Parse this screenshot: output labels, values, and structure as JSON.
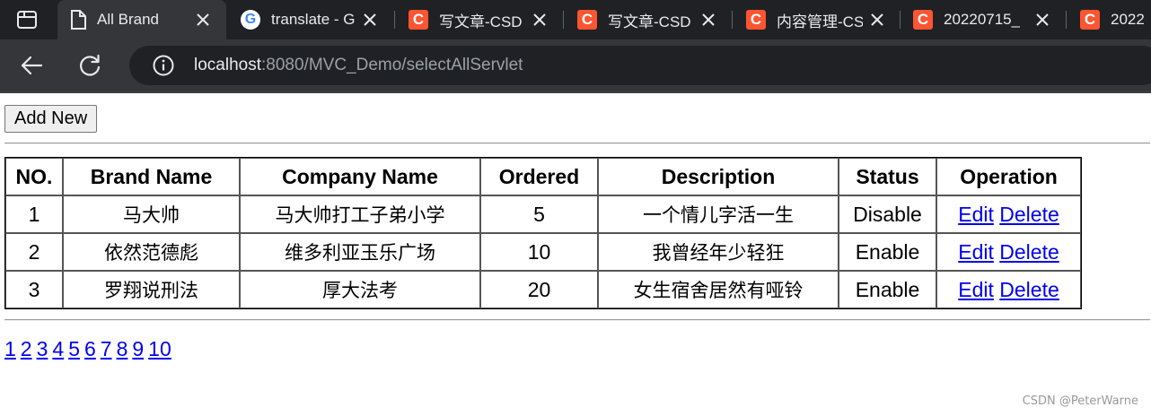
{
  "browser": {
    "tabs": [
      {
        "title": "All Brand",
        "favicon": "page-icon",
        "active": true
      },
      {
        "title": "translate - G",
        "favicon": "google-icon",
        "active": false
      },
      {
        "title": "写文章-CSDN",
        "favicon": "csdn-icon",
        "active": false
      },
      {
        "title": "写文章-CSDN",
        "favicon": "csdn-icon",
        "active": false
      },
      {
        "title": "内容管理-CSDN",
        "favicon": "csdn-icon",
        "active": false
      },
      {
        "title": "20220715_",
        "favicon": "csdn-icon",
        "active": false
      },
      {
        "title": "2022",
        "favicon": "csdn-icon",
        "active": false
      }
    ],
    "address": {
      "host": "localhost",
      "path": ":8080/MVC_Demo/selectAllServlet"
    },
    "favicon_letters": {
      "csdn": "C",
      "google": "G"
    }
  },
  "page": {
    "add_button": "Add New",
    "table": {
      "headers": [
        "NO.",
        "Brand Name",
        "Company Name",
        "Ordered",
        "Description",
        "Status",
        "Operation"
      ],
      "rows": [
        {
          "no": "1",
          "brand": "马大帅",
          "company": "马大帅打工子弟小学",
          "ordered": "5",
          "description": "一个情儿字活一生",
          "status": "Disable",
          "edit": "Edit",
          "delete": "Delete"
        },
        {
          "no": "2",
          "brand": "依然范德彪",
          "company": "维多利亚玉乐广场",
          "ordered": "10",
          "description": "我曾经年少轻狂",
          "status": "Enable",
          "edit": "Edit",
          "delete": "Delete"
        },
        {
          "no": "3",
          "brand": "罗翔说刑法",
          "company": "厚大法考",
          "ordered": "20",
          "description": "女生宿舍居然有哑铃",
          "status": "Enable",
          "edit": "Edit",
          "delete": "Delete"
        }
      ]
    },
    "pagination": [
      "1",
      "2",
      "3",
      "4",
      "5",
      "6",
      "7",
      "8",
      "9",
      "10"
    ],
    "watermark": "CSDN @PeterWarne"
  },
  "colors": {
    "tabbar": "#202124",
    "toolbar": "#35363a",
    "link": "#0000ee",
    "csdn": "#fc5531"
  }
}
